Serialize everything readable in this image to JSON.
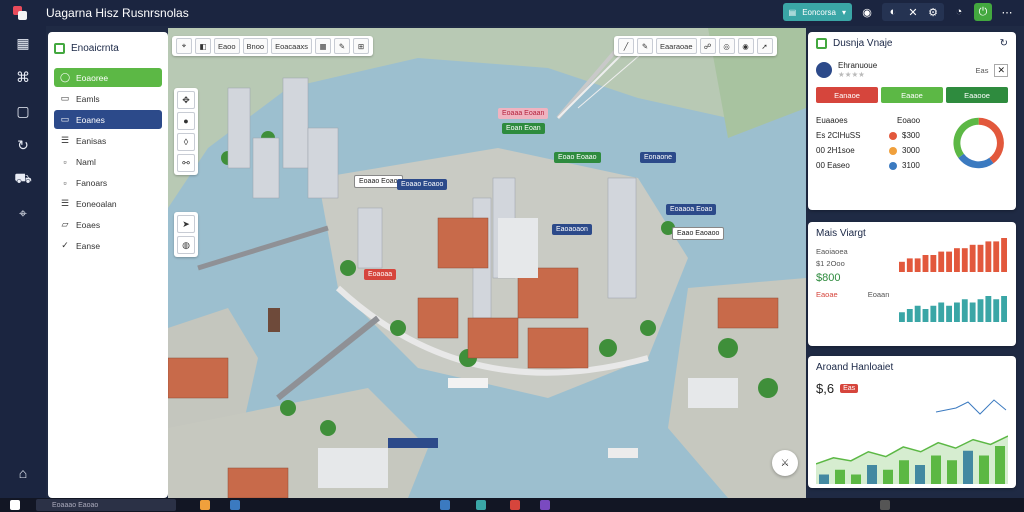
{
  "window": {
    "title": "Uagarna Hisz Rusnrsnolas"
  },
  "topbar": {
    "share_label": "Eoncorsa"
  },
  "leftpanel": {
    "title": "Enoaicrnta",
    "items": [
      {
        "label": "Eoaoree",
        "style": "green"
      },
      {
        "label": "Eamls",
        "style": "plain"
      },
      {
        "label": "Eoanes",
        "style": "blue"
      },
      {
        "label": "Eanisas",
        "style": "plain"
      },
      {
        "label": "Naml",
        "style": "plain"
      },
      {
        "label": "Fanoars",
        "style": "plain"
      },
      {
        "label": "Eoneoalan",
        "style": "plain"
      },
      {
        "label": "Eoaes",
        "style": "plain"
      },
      {
        "label": "Eanse",
        "style": "plain"
      }
    ]
  },
  "map": {
    "toolbar_left": [
      "Eaoo",
      "Bnoo",
      "Eoacaaxs"
    ],
    "toolbar_right": [
      "Eaaraoae"
    ],
    "pins": [
      "Eoaaa Eoaan",
      "Eoan Eoan",
      "Eoao Eoaao",
      "Eonaone",
      "Eoaao Eoao",
      "Eoaao Eoaoo",
      "Eoaaoa Eoao",
      "Eaoaoaon",
      "Eaao Eaoaoo",
      "Eoaoaa"
    ]
  },
  "rightpanel": {
    "card1": {
      "title": "Dusnja Vnaje",
      "user_name": "Ehranuoue",
      "user_extra": "Eas",
      "buttons": [
        "Eanaoe",
        "Eaaoe",
        "Eaaooe"
      ],
      "buttons_colors": [
        "#d6453c",
        "#5cb845",
        "#2e8b3e"
      ],
      "stats_header": [
        "Euaaoes",
        "Eoaoo"
      ],
      "stats": [
        {
          "label": "Es 2ClHuSS",
          "value": "$300"
        },
        {
          "label": "00 2H1soe",
          "value": "3000"
        },
        {
          "label": "00 Easeo",
          "value": "3100"
        }
      ],
      "donut": [
        40,
        25,
        35
      ],
      "donut_colors": [
        "#e2583c",
        "#3b7ac0",
        "#5cb845"
      ]
    },
    "card2": {
      "title": "Mais Viargt",
      "label1": "Eaoiaoea",
      "label2": "$1 2Ooo",
      "value": "$800",
      "label3": "Eaoae",
      "label4": "Eoaan",
      "bars_red": [
        3,
        4,
        4,
        5,
        5,
        6,
        6,
        7,
        7,
        8,
        8,
        9,
        9,
        10
      ],
      "bars_teal": [
        3,
        4,
        5,
        4,
        5,
        6,
        5,
        6,
        7,
        6,
        7,
        8,
        7,
        8
      ]
    },
    "card3": {
      "title": "Aroand Hanloaiet",
      "value": "$,6",
      "badge": "Eas",
      "line": [
        2,
        3,
        2.5,
        4,
        3.2,
        4.8,
        4,
        5.5,
        4.6,
        6,
        5.2,
        6.6
      ],
      "bars": [
        2,
        3,
        2,
        4,
        3,
        5,
        4,
        6,
        5,
        7,
        6,
        8
      ]
    },
    "colors": {
      "accent": "#2c4a8a",
      "success": "#5cb845",
      "danger": "#d6453c"
    }
  },
  "taskbar": {
    "search_placeholder": "Eoaaao Eaoao"
  }
}
